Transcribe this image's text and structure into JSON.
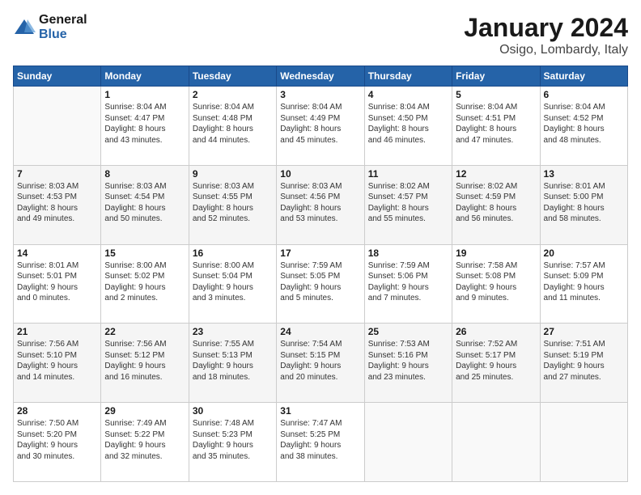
{
  "logo": {
    "text_general": "General",
    "text_blue": "Blue"
  },
  "header": {
    "title": "January 2024",
    "subtitle": "Osigo, Lombardy, Italy"
  },
  "days_of_week": [
    "Sunday",
    "Monday",
    "Tuesday",
    "Wednesday",
    "Thursday",
    "Friday",
    "Saturday"
  ],
  "weeks": [
    [
      {
        "num": "",
        "info": ""
      },
      {
        "num": "1",
        "info": "Sunrise: 8:04 AM\nSunset: 4:47 PM\nDaylight: 8 hours\nand 43 minutes."
      },
      {
        "num": "2",
        "info": "Sunrise: 8:04 AM\nSunset: 4:48 PM\nDaylight: 8 hours\nand 44 minutes."
      },
      {
        "num": "3",
        "info": "Sunrise: 8:04 AM\nSunset: 4:49 PM\nDaylight: 8 hours\nand 45 minutes."
      },
      {
        "num": "4",
        "info": "Sunrise: 8:04 AM\nSunset: 4:50 PM\nDaylight: 8 hours\nand 46 minutes."
      },
      {
        "num": "5",
        "info": "Sunrise: 8:04 AM\nSunset: 4:51 PM\nDaylight: 8 hours\nand 47 minutes."
      },
      {
        "num": "6",
        "info": "Sunrise: 8:04 AM\nSunset: 4:52 PM\nDaylight: 8 hours\nand 48 minutes."
      }
    ],
    [
      {
        "num": "7",
        "info": "Sunrise: 8:03 AM\nSunset: 4:53 PM\nDaylight: 8 hours\nand 49 minutes."
      },
      {
        "num": "8",
        "info": "Sunrise: 8:03 AM\nSunset: 4:54 PM\nDaylight: 8 hours\nand 50 minutes."
      },
      {
        "num": "9",
        "info": "Sunrise: 8:03 AM\nSunset: 4:55 PM\nDaylight: 8 hours\nand 52 minutes."
      },
      {
        "num": "10",
        "info": "Sunrise: 8:03 AM\nSunset: 4:56 PM\nDaylight: 8 hours\nand 53 minutes."
      },
      {
        "num": "11",
        "info": "Sunrise: 8:02 AM\nSunset: 4:57 PM\nDaylight: 8 hours\nand 55 minutes."
      },
      {
        "num": "12",
        "info": "Sunrise: 8:02 AM\nSunset: 4:59 PM\nDaylight: 8 hours\nand 56 minutes."
      },
      {
        "num": "13",
        "info": "Sunrise: 8:01 AM\nSunset: 5:00 PM\nDaylight: 8 hours\nand 58 minutes."
      }
    ],
    [
      {
        "num": "14",
        "info": "Sunrise: 8:01 AM\nSunset: 5:01 PM\nDaylight: 9 hours\nand 0 minutes."
      },
      {
        "num": "15",
        "info": "Sunrise: 8:00 AM\nSunset: 5:02 PM\nDaylight: 9 hours\nand 2 minutes."
      },
      {
        "num": "16",
        "info": "Sunrise: 8:00 AM\nSunset: 5:04 PM\nDaylight: 9 hours\nand 3 minutes."
      },
      {
        "num": "17",
        "info": "Sunrise: 7:59 AM\nSunset: 5:05 PM\nDaylight: 9 hours\nand 5 minutes."
      },
      {
        "num": "18",
        "info": "Sunrise: 7:59 AM\nSunset: 5:06 PM\nDaylight: 9 hours\nand 7 minutes."
      },
      {
        "num": "19",
        "info": "Sunrise: 7:58 AM\nSunset: 5:08 PM\nDaylight: 9 hours\nand 9 minutes."
      },
      {
        "num": "20",
        "info": "Sunrise: 7:57 AM\nSunset: 5:09 PM\nDaylight: 9 hours\nand 11 minutes."
      }
    ],
    [
      {
        "num": "21",
        "info": "Sunrise: 7:56 AM\nSunset: 5:10 PM\nDaylight: 9 hours\nand 14 minutes."
      },
      {
        "num": "22",
        "info": "Sunrise: 7:56 AM\nSunset: 5:12 PM\nDaylight: 9 hours\nand 16 minutes."
      },
      {
        "num": "23",
        "info": "Sunrise: 7:55 AM\nSunset: 5:13 PM\nDaylight: 9 hours\nand 18 minutes."
      },
      {
        "num": "24",
        "info": "Sunrise: 7:54 AM\nSunset: 5:15 PM\nDaylight: 9 hours\nand 20 minutes."
      },
      {
        "num": "25",
        "info": "Sunrise: 7:53 AM\nSunset: 5:16 PM\nDaylight: 9 hours\nand 23 minutes."
      },
      {
        "num": "26",
        "info": "Sunrise: 7:52 AM\nSunset: 5:17 PM\nDaylight: 9 hours\nand 25 minutes."
      },
      {
        "num": "27",
        "info": "Sunrise: 7:51 AM\nSunset: 5:19 PM\nDaylight: 9 hours\nand 27 minutes."
      }
    ],
    [
      {
        "num": "28",
        "info": "Sunrise: 7:50 AM\nSunset: 5:20 PM\nDaylight: 9 hours\nand 30 minutes."
      },
      {
        "num": "29",
        "info": "Sunrise: 7:49 AM\nSunset: 5:22 PM\nDaylight: 9 hours\nand 32 minutes."
      },
      {
        "num": "30",
        "info": "Sunrise: 7:48 AM\nSunset: 5:23 PM\nDaylight: 9 hours\nand 35 minutes."
      },
      {
        "num": "31",
        "info": "Sunrise: 7:47 AM\nSunset: 5:25 PM\nDaylight: 9 hours\nand 38 minutes."
      },
      {
        "num": "",
        "info": ""
      },
      {
        "num": "",
        "info": ""
      },
      {
        "num": "",
        "info": ""
      }
    ]
  ]
}
